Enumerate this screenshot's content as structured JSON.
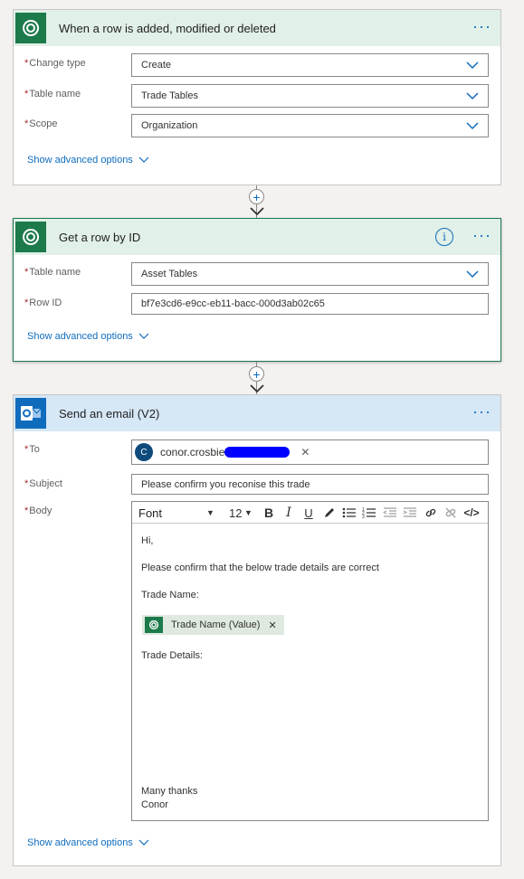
{
  "card1": {
    "title": "When a row is added, modified or deleted",
    "fields": [
      {
        "label": "Change type",
        "value": "Create"
      },
      {
        "label": "Table name",
        "value": "Trade Tables"
      },
      {
        "label": "Scope",
        "value": "Organization"
      }
    ],
    "advanced_label": "Show advanced options"
  },
  "card2": {
    "title": "Get a row by ID",
    "fields": [
      {
        "label": "Table name",
        "value": "Asset Tables"
      },
      {
        "label": "Row ID",
        "value": "bf7e3cd6-e9cc-eb11-bacc-000d3ab02c65"
      }
    ],
    "advanced_label": "Show advanced options"
  },
  "card3": {
    "title": "Send an email (V2)",
    "to_label": "To",
    "to_avatar": "C",
    "to_value": "conor.crosbie",
    "subject_label": "Subject",
    "subject_value": "Please confirm you reconise this trade",
    "body_label": "Body",
    "toolbar": {
      "font": "Font",
      "size": "12"
    },
    "body": {
      "line1": "Hi,",
      "line2": "Please confirm that the below trade details are correct",
      "line3": "Trade Name:",
      "token": "Trade Name (Value)",
      "line4": "Trade Details:",
      "line5": "Many thanks",
      "line6": "Conor"
    },
    "advanced_label": "Show advanced options"
  },
  "icons": {
    "menu": "ellipsis-icon",
    "info": "info-icon",
    "dropdown": "chevron-down-icon",
    "add": "plus-icon"
  },
  "colors": {
    "accent": "#0f6cbd",
    "dataverse": "#1c7a4b",
    "required": "#a4262c"
  }
}
